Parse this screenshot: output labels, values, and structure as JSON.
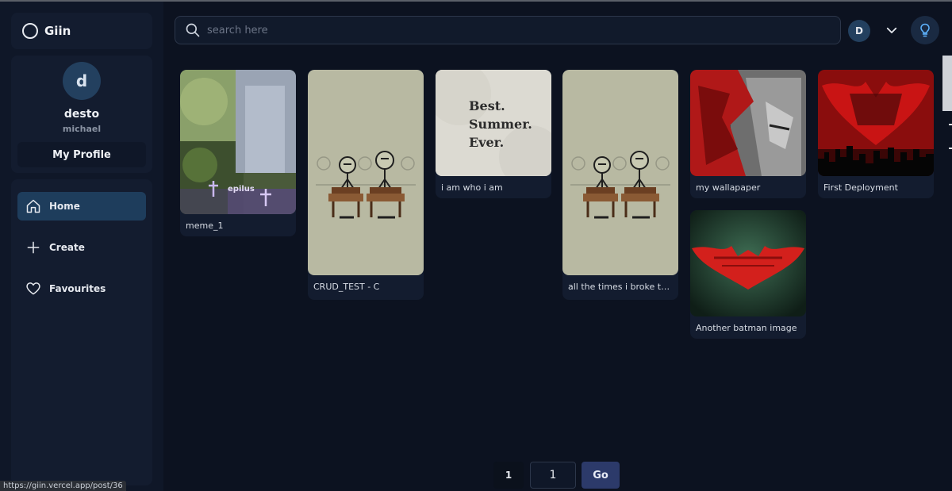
{
  "app": {
    "brand": "Giin"
  },
  "profile": {
    "avatar_letter": "d",
    "name": "desto",
    "username": "michael",
    "my_profile_label": "My Profile"
  },
  "nav": {
    "items": [
      {
        "label": "Home",
        "icon": "home-icon",
        "active": true
      },
      {
        "label": "Create",
        "icon": "plus-icon",
        "active": false
      },
      {
        "label": "Favourites",
        "icon": "heart-icon",
        "active": false
      }
    ]
  },
  "search": {
    "placeholder": "search here",
    "value": ""
  },
  "header": {
    "avatar_letter": "D"
  },
  "posts": [
    {
      "title": "meme_1"
    },
    {
      "title": "CRUD_TEST - C"
    },
    {
      "title": "i am who i am",
      "image_text": [
        "Best.",
        "Summer.",
        "Ever."
      ]
    },
    {
      "title": "all the times i broke th..."
    },
    {
      "title": "my wallapaper"
    },
    {
      "title": "First Deployment"
    },
    {
      "title": "Another batman image"
    }
  ],
  "pagination": {
    "current": "1",
    "input_value": "1",
    "go_label": "Go"
  },
  "status_bar": {
    "url": "https://giin.vercel.app/post/36"
  },
  "colors": {
    "background": "#0c1220",
    "sidebar": "#0f1728",
    "card": "#131c2f",
    "active_nav": "#1e3d5c",
    "go_button": "#2c3a6a"
  }
}
